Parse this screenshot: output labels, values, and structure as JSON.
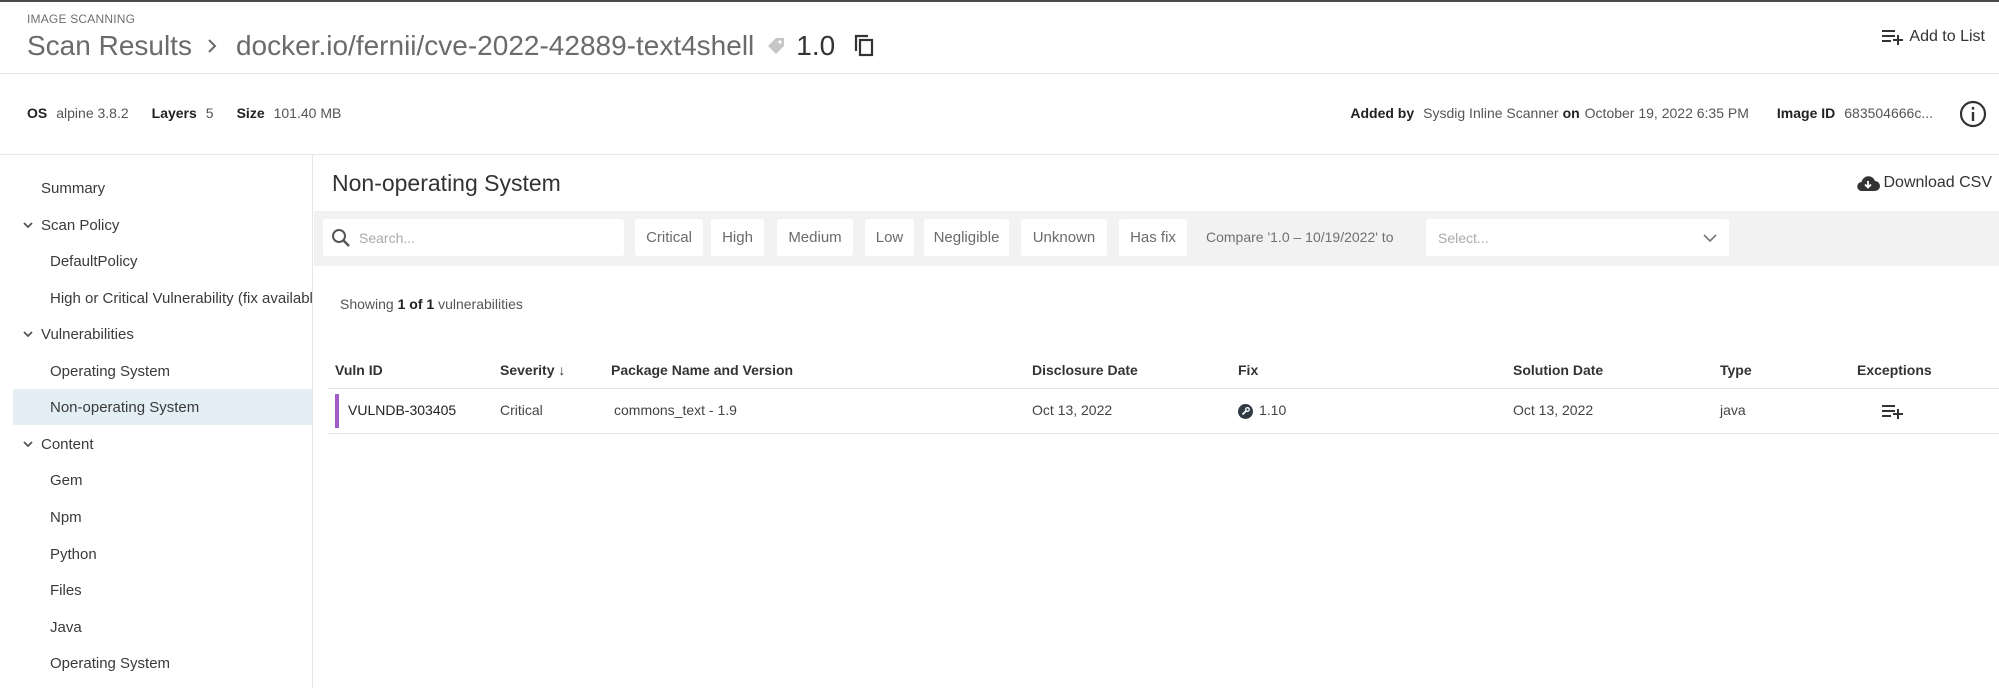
{
  "header": {
    "eyebrow": "IMAGE SCANNING",
    "crumb": "Scan Results",
    "repo": "docker.io/fernii/cve-2022-42889-text4shell",
    "tag": "1.0",
    "add_to_list": "Add to List"
  },
  "meta": {
    "os_label": "OS",
    "os_value": "alpine 3.8.2",
    "layers_label": "Layers",
    "layers_value": "5",
    "size_label": "Size",
    "size_value": "101.40 MB",
    "added_by_label": "Added by",
    "added_by_value": "Sysdig Inline Scanner",
    "on_label": "on",
    "on_value": "October 19, 2022 6:35 PM",
    "image_id_label": "Image ID",
    "image_id_value": "683504666c..."
  },
  "sidebar": {
    "summary": "Summary",
    "scan_policy": "Scan Policy",
    "default_policy": "DefaultPolicy",
    "high_critical": "High or Critical Vulnerability (fix available)",
    "vulnerabilities": "Vulnerabilities",
    "vuln_os": "Operating System",
    "vuln_non_os": "Non-operating System",
    "content": "Content",
    "gem": "Gem",
    "npm": "Npm",
    "python": "Python",
    "files": "Files",
    "java": "Java",
    "content_os": "Operating System"
  },
  "main": {
    "section_title": "Non-operating System",
    "download_csv": "Download CSV",
    "search_placeholder": "Search...",
    "filters": {
      "critical": "Critical",
      "high": "High",
      "medium": "Medium",
      "low": "Low",
      "negligible": "Negligible",
      "unknown": "Unknown",
      "has_fix": "Has fix"
    },
    "compare_text": "Compare '1.0 – 10/19/2022' to",
    "select_placeholder": "Select...",
    "showing_prefix": "Showing",
    "showing_count": "1 of 1",
    "showing_suffix": "vulnerabilities"
  },
  "table": {
    "headers": {
      "vuln_id": "Vuln ID",
      "severity": "Severity ↓",
      "package": "Package Name and Version",
      "disclosure": "Disclosure Date",
      "fix": "Fix",
      "solution": "Solution Date",
      "type": "Type",
      "exceptions": "Exceptions"
    },
    "rows": [
      {
        "vuln_id": "VULNDB-303405",
        "severity": "Critical",
        "package": "commons_text - 1.9",
        "disclosure": "Oct 13, 2022",
        "fix": "1.10",
        "solution": "Oct 13, 2022",
        "type": "java"
      }
    ]
  },
  "colors": {
    "critical": "#a15cc7",
    "selected_nav_bg": "#e3eff4",
    "filter_bar_bg": "#f2f2f2"
  }
}
